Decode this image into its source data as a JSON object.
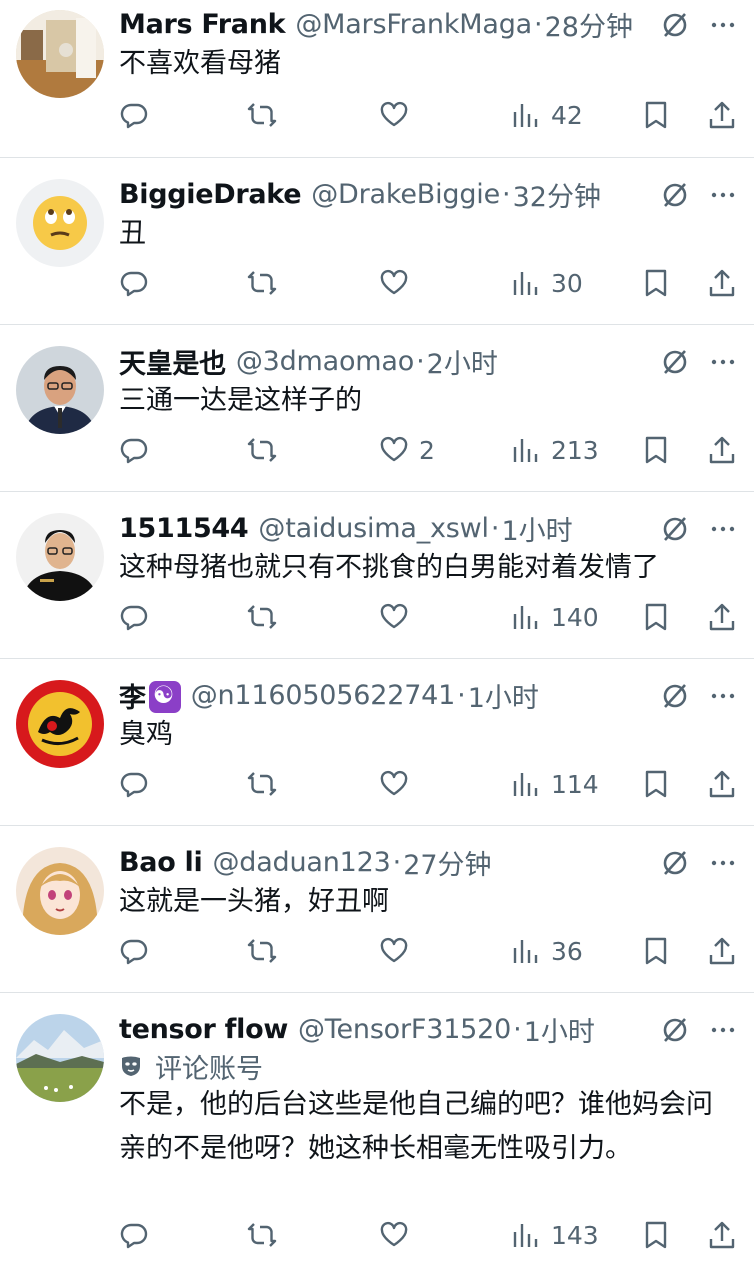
{
  "tweets": [
    {
      "name": "Mars Frank",
      "handle": "@MarsFrankMaga",
      "dot": "·",
      "time": "28分钟",
      "text": "不喜欢看母猪",
      "likes": "",
      "views": "42",
      "avatar": "room"
    },
    {
      "name": "BiggieDrake",
      "handle": "@DrakeBiggie",
      "dot": "·",
      "time": "32分钟",
      "text": "丑",
      "likes": "",
      "views": "30",
      "avatar": "emoji-eyeroll"
    },
    {
      "name": "天皇是也",
      "handle": "@3dmaomao",
      "dot": "·",
      "time": "2小时",
      "text": "三通一达是这样子的",
      "likes": "2",
      "views": "213",
      "avatar": "man-suit"
    },
    {
      "name": "1511544",
      "handle": "@taidusima_xswl",
      "dot": "·",
      "time": "1小时",
      "text": "这种母猪也就只有不挑食的白男能对着发情了",
      "likes": "",
      "views": "140",
      "avatar": "man-black"
    },
    {
      "name": "李",
      "handle": "@n1160505622741",
      "dot": "·",
      "time": "1小时",
      "text": "臭鸡",
      "likes": "",
      "views": "114",
      "avatar": "dragon-flag"
    },
    {
      "name": "Bao li",
      "handle": "@daduan123",
      "dot": "·",
      "time": "27分钟",
      "text": "这就是一头猪，好丑啊",
      "likes": "",
      "views": "36",
      "avatar": "anime-girl"
    },
    {
      "name": "tensor flow",
      "handle": "@TensorF31520",
      "dot": "·",
      "time": "1小时",
      "sub_label": "评论账号",
      "text": "不是，他的后台这些是他自己编的吧？谁他妈会问亲的不是他呀？她这种长相毫无性吸引力。",
      "likes": "",
      "views": "143",
      "avatar": "landscape"
    }
  ],
  "icons": {
    "reply": "reply-icon",
    "retweet": "retweet-icon",
    "like": "heart-icon",
    "views": "views-icon",
    "bookmark": "bookmark-icon",
    "share": "share-icon",
    "grok": "grok-icon",
    "more": "more-icon"
  },
  "colors": {
    "text": "#0f1419",
    "secondary": "#536471",
    "divider": "#dfe3e6"
  }
}
